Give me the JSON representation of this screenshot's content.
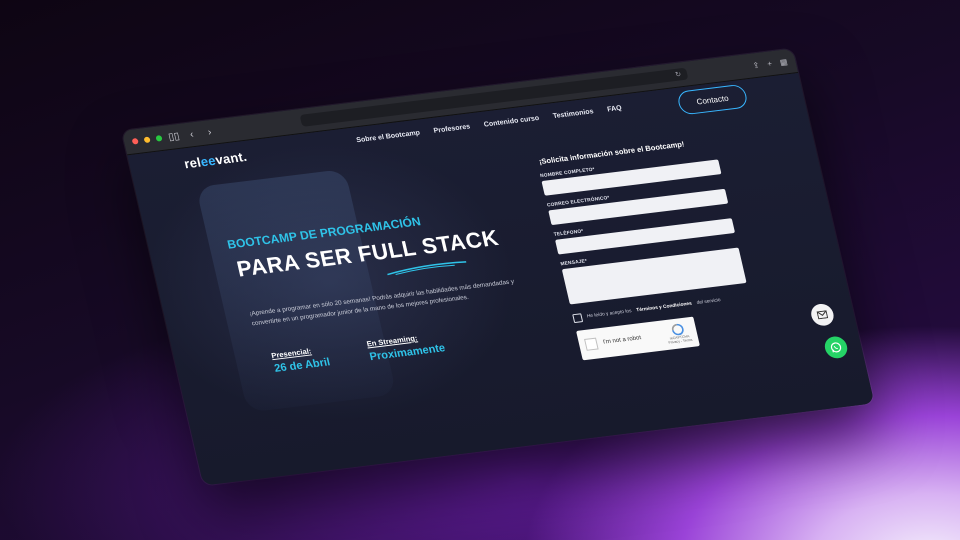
{
  "browser": {
    "tabs_icon": "sidebar-icon",
    "reload_icon": "reload-icon",
    "share_icon": "share-icon",
    "new_tab_icon": "plus-icon",
    "tab_overview_icon": "grid-icon"
  },
  "nav": {
    "logo_left": "rel",
    "logo_highlight": "ee",
    "logo_right": "vant.",
    "links": [
      "Sobre el Bootcamp",
      "Profesores",
      "Contenido curso",
      "Testimonios",
      "FAQ"
    ],
    "cta": "Contacto"
  },
  "hero": {
    "kicker": "BOOTCAMP DE PROGRAMACIÓN",
    "title": "PARA SER FULL STACK",
    "description": "¡Aprende a programar en sólo 20 semanas! Podrás adquirir las habilidades más demandadas y convertirte en un programador junior de la mano de los mejores profesionales.",
    "presencial_label": "Presencial:",
    "presencial_value": "26 de Abril",
    "streaming_label": "En Streaming:",
    "streaming_value": "Proximamente"
  },
  "form": {
    "title": "¡Solicita información sobre el Bootcamp!",
    "name_label": "NOMBRE COMPLETO*",
    "email_label": "CORREO ELECTRÓNICO*",
    "phone_label": "TELÉFONO*",
    "message_label": "MENSAJE*",
    "terms_prefix": "He leído y acepto los",
    "terms_link": "Términos y Condiciones",
    "terms_suffix": "del servicio",
    "captcha_text": "I'm not a robot",
    "captcha_brand": "reCAPTCHA",
    "captcha_sub": "Privacy - Terms"
  },
  "colors": {
    "accent": "#38b6ff",
    "kicker": "#2fc3e8",
    "whatsapp": "#25d366"
  }
}
